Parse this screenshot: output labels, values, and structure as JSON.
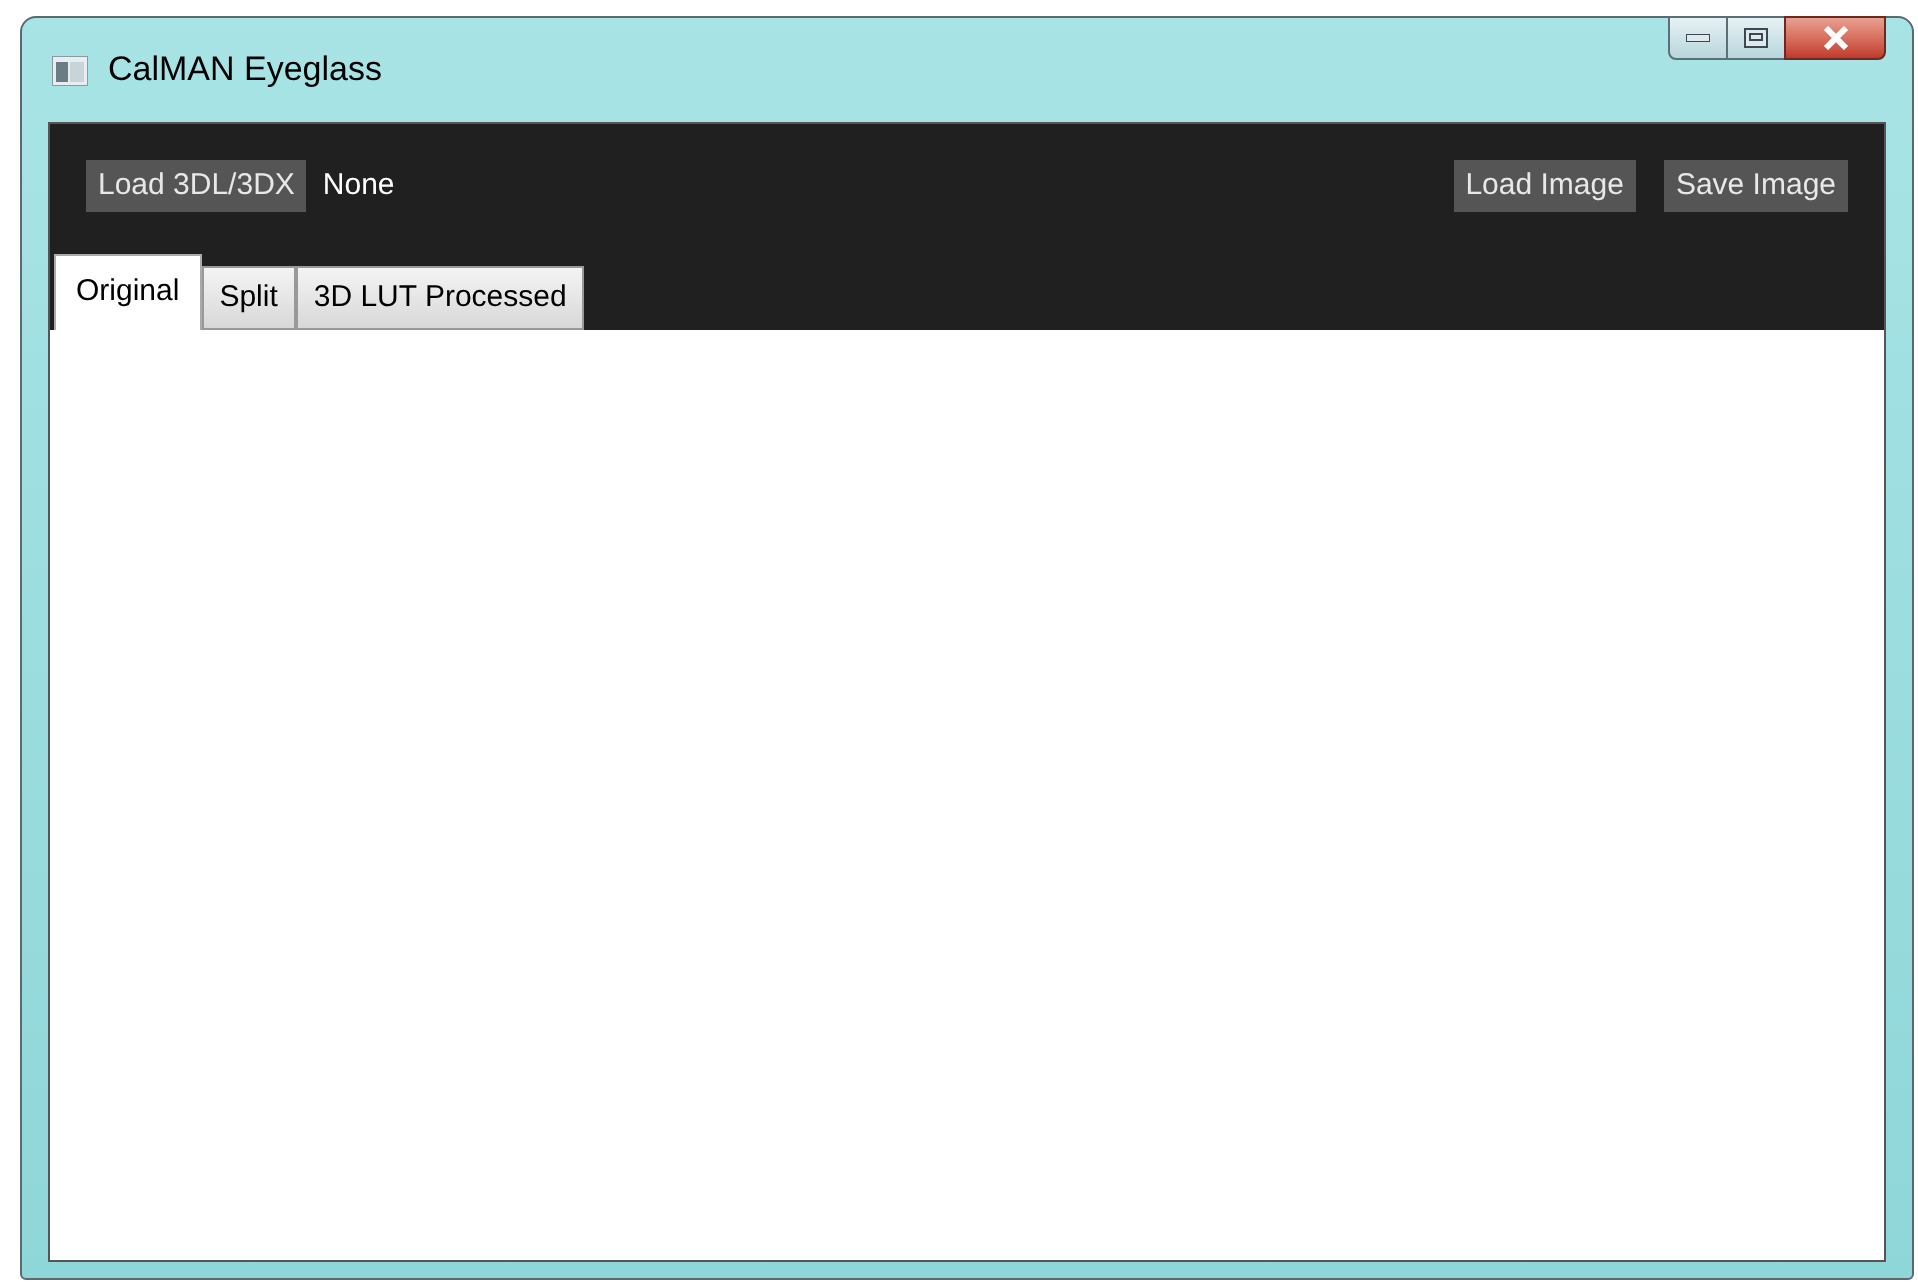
{
  "window": {
    "title": "CalMAN Eyeglass"
  },
  "toolbar": {
    "load_lut_button": "Load 3DL/3DX",
    "lut_file": "None",
    "load_image_button": "Load Image",
    "save_image_button": "Save Image"
  },
  "tabs": [
    {
      "label": "Original",
      "selected": true
    },
    {
      "label": "Split",
      "selected": false
    },
    {
      "label": "3D LUT Processed",
      "selected": false
    }
  ]
}
